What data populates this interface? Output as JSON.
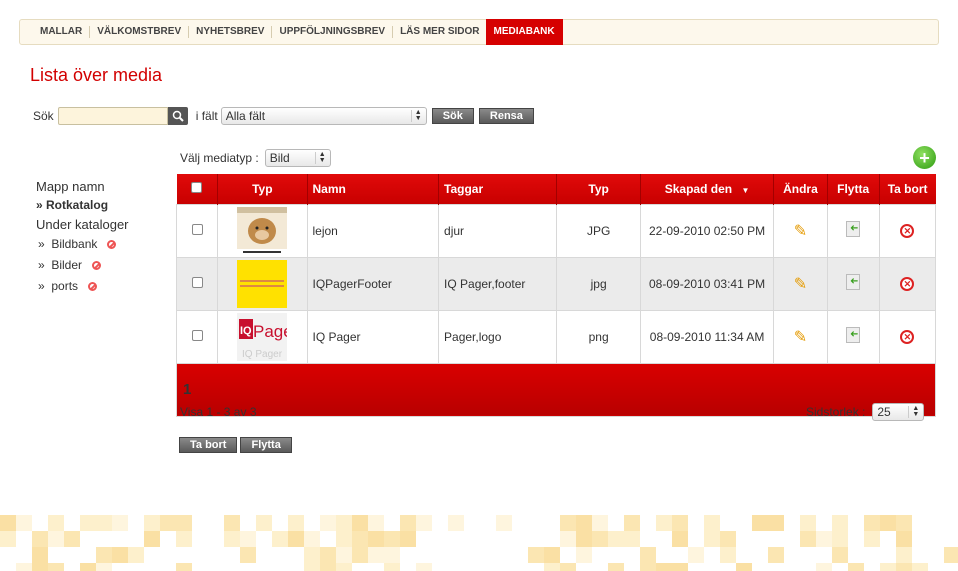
{
  "nav": {
    "items": [
      {
        "label": "MALLAR"
      },
      {
        "label": "VÄLKOMSTBREV"
      },
      {
        "label": "NYHETSBREV"
      },
      {
        "label": "UPPFÖLJNINGSBREV"
      },
      {
        "label": "LÄS MER SIDOR"
      },
      {
        "label": "MEDIABANK",
        "active": true
      }
    ]
  },
  "page": {
    "title": "Lista över media"
  },
  "search": {
    "label": "Sök",
    "value": "",
    "in_field_label": "i fält",
    "field_select": "Alla fält",
    "search_button": "Sök",
    "clear_button": "Rensa"
  },
  "folders": {
    "folder_name_label": "Mapp namn",
    "root": "Rotkatalog",
    "subfolders_label": "Under kataloger",
    "items": [
      {
        "label": "Bildbank"
      },
      {
        "label": "Bilder"
      },
      {
        "label": "ports"
      }
    ]
  },
  "mediatype": {
    "label": "Välj mediatyp :",
    "value": "Bild"
  },
  "table": {
    "headers": {
      "type_thumb": "Typ",
      "name": "Namn",
      "tags": "Taggar",
      "type": "Typ",
      "created": "Skapad den",
      "edit": "Ändra",
      "move": "Flytta",
      "delete": "Ta bort"
    },
    "rows": [
      {
        "name": "lejon",
        "tags": "djur",
        "type": "JPG",
        "created": "22-09-2010 02:50 PM"
      },
      {
        "name": "IQPagerFooter",
        "tags": "IQ Pager,footer",
        "type": "jpg",
        "created": "08-09-2010 03:41 PM"
      },
      {
        "name": "IQ Pager",
        "tags": "Pager,logo",
        "type": "png",
        "created": "08-09-2010 11:34 AM"
      }
    ],
    "current_page": "1"
  },
  "summary": "Visa 1 - 3 av 3",
  "pagesize": {
    "label": "Sidstorlek :",
    "value": "25"
  },
  "actions": {
    "delete": "Ta bort",
    "move": "Flytta"
  },
  "colors": {
    "accent": "#d60000",
    "header_bg": "#fdf8ec"
  }
}
